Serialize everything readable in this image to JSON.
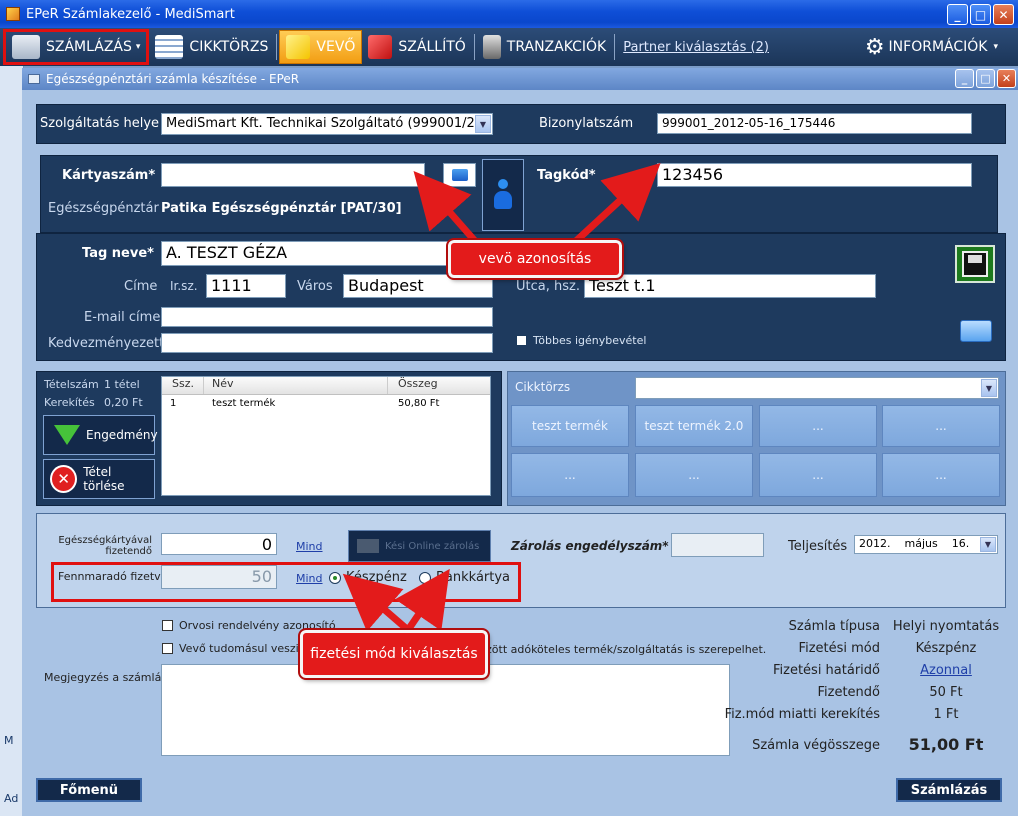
{
  "window": {
    "title": "EPeR Számlakezelő - MediSmart"
  },
  "toolbar": {
    "szamlazas": "SZÁMLÁZÁS",
    "cikktorzs": "CIKKTÖRZS",
    "vevo": "VEVŐ",
    "szallito": "SZÁLLÍTÓ",
    "tranzakciok": "TRANZAKCIÓK",
    "partner_link": "Partner kiválasztás (2)",
    "informaciok": "INFORMÁCIÓK"
  },
  "child": {
    "title": "Egészségpénztári számla készítése - EPeR"
  },
  "service": {
    "label": "Szolgáltatás helye",
    "value": "MediSmart Kft. Technikai Szolgáltató (999001/20)",
    "doc_label": "Bizonylatszám",
    "doc_value": "999001_2012-05-16_175446"
  },
  "card": {
    "card_label": "Kártyaszám*",
    "card_value": "",
    "fund_label": "Egészségpénztár",
    "fund_value": "Patika Egészségpénztár [PAT/30]",
    "member_label": "Tagkód*",
    "member_value": "123456"
  },
  "customer": {
    "name_label": "Tag neve*",
    "name_value": "A. TESZT GÉZA",
    "addr_label": "Címe",
    "zip_label": "Ir.sz.",
    "zip_value": "1111",
    "city_label": "Város",
    "city_value": "Budapest",
    "street_label": "Utca, hsz.",
    "street_value": "Teszt t.1",
    "email_label": "E-mail címe",
    "email_value": "",
    "benef_label": "Kedvezményezett",
    "benef_value": "",
    "multi_label": "Többes igénybevétel"
  },
  "items": {
    "count_label": "Tételszám",
    "count_value": "1 tétel",
    "round_label": "Kerekítés",
    "round_value": "0,20 Ft",
    "discount_btn": "Engedmény",
    "delete_btn": "Tétel törlése",
    "columns": [
      "Ssz.",
      "Név",
      "Összeg"
    ],
    "rows": [
      {
        "ssz": "1",
        "nev": "teszt termék",
        "osszeg": "50,80 Ft"
      }
    ]
  },
  "catalog": {
    "label": "Cikktörzs",
    "combo_value": "",
    "tiles": [
      "teszt termék",
      "teszt termék 2.0",
      "...",
      "...",
      "...",
      "...",
      "...",
      "..."
    ]
  },
  "payment": {
    "card_pay_label": "Egészségkártyával fizetendő",
    "card_pay_value": "0",
    "mind1": "Mind",
    "online_btn": "Kési Online zárolás",
    "remaining_label": "Fennmaradó fizetve",
    "remaining_value": "50",
    "mind2": "Mind",
    "cash": "Készpénz",
    "bankcard": "Bankkártya",
    "lock_label": "Zárolás engedélyszám*",
    "lock_value": "",
    "perf_label": "Teljesítés",
    "perf_year": "2012.",
    "perf_month": "május",
    "perf_day": "16."
  },
  "bottom": {
    "rx_label": "Orvosi rendelvény azonosító",
    "consent_a": "Vevő tudomásul veszi, ho",
    "consent_b": "zött adóköteles termék/szolgáltatás is szerepelhet.",
    "note_label": "Megjegyzés a számlán",
    "note_value": ""
  },
  "summary": {
    "type_label": "Számla típusa",
    "type_value": "Helyi nyomtatás",
    "method_label": "Fizetési mód",
    "method_value": "Készpénz",
    "due_label": "Fizetési határidő",
    "due_value": "Azonnal",
    "payable_label": "Fizetendő",
    "payable_value": "50 Ft",
    "round_label": "Fiz.mód miatti kerekítés",
    "round_value": "1 Ft",
    "total_label": "Számla végösszege",
    "total_value": "51,00 Ft"
  },
  "footer": {
    "main_menu": "Főmenü",
    "invoice": "Számlázás"
  },
  "callouts": {
    "buyer": "vevö azonosítás",
    "payment": "fizetési mód kiválasztás"
  },
  "left_strip_items": [
    "M",
    "Ad"
  ],
  "colors": {
    "accent_red": "#e31b1b",
    "panel_dark": "#1e3a5e",
    "vevo_orange": "#f29d13"
  }
}
